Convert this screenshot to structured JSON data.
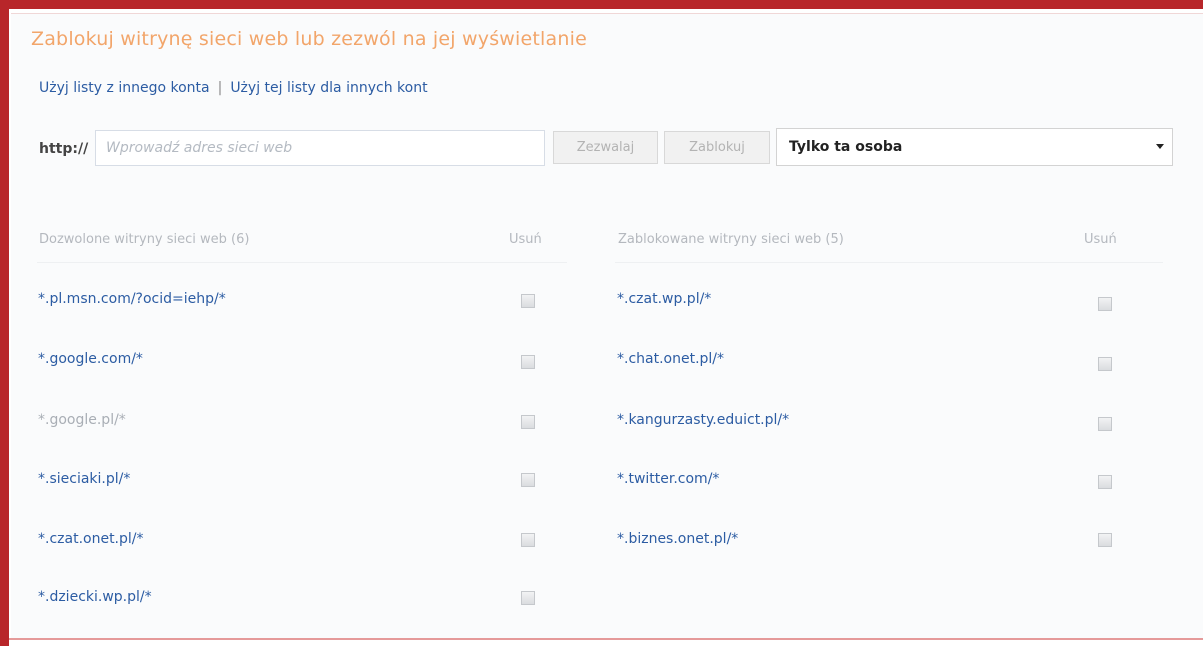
{
  "title": "Zablokuj witrynę sieci web lub zezwól na jej wyświetlanie",
  "links": {
    "use_other": "Użyj listy z innego konta",
    "separator": "|",
    "use_for_others": "Użyj tej listy dla innych kont"
  },
  "form": {
    "prefix": "http://",
    "placeholder": "Wprowadź adres sieci web",
    "allow_label": "Zezwalaj",
    "block_label": "Zablokuj",
    "scope_value": "Tylko ta osoba"
  },
  "allowed": {
    "header": "Dozwolone witryny sieci web (6)",
    "remove_header": "Usuń",
    "items": [
      {
        "url": "*.pl.msn.com/?ocid=iehp/*"
      },
      {
        "url": "*.google.com/*"
      },
      {
        "url": "*.google.pl/*"
      },
      {
        "url": "*.sieciaki.pl/*"
      },
      {
        "url": "*.czat.onet.pl/*"
      },
      {
        "url": "*.dziecki.wp.pl/*"
      }
    ]
  },
  "blocked": {
    "header": "Zablokowane witryny sieci web (5)",
    "remove_header": "Usuń",
    "items": [
      {
        "url": "*.czat.wp.pl/*"
      },
      {
        "url": "*.chat.onet.pl/*"
      },
      {
        "url": "*.kangurzasty.eduict.pl/*"
      },
      {
        "url": "*.twitter.com/*"
      },
      {
        "url": "*.biznes.onet.pl/*"
      }
    ]
  },
  "colors": {
    "frame": "#b8262a",
    "title": "#f2a56a",
    "link": "#2c5ca3"
  }
}
